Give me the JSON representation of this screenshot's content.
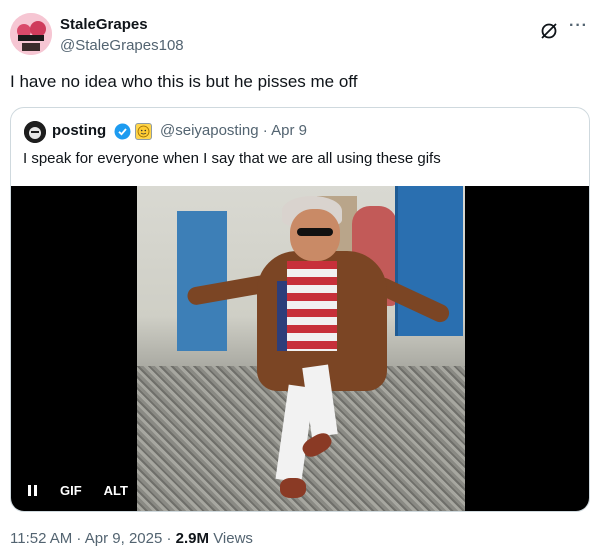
{
  "tweet": {
    "author_name": "StaleGrapes",
    "author_handle": "@StaleGrapes108",
    "text": "I have no idea who this is but he pisses me off",
    "timestamp": "11:52 AM · Apr 9, 2025 ·",
    "views_count": "2.9M",
    "views_label": "Views"
  },
  "quoted": {
    "author_name": "posting",
    "author_handle": "@seiyaposting · Apr 9",
    "text": "I speak for everyone when I say that we are all using these gifs",
    "verified": true
  },
  "media": {
    "type": "GIF",
    "gif_label": "GIF",
    "alt_label": "ALT",
    "playing": true
  },
  "icons": {
    "grok": "grok-icon",
    "more": "more-icon",
    "verified": "verified-badge-icon",
    "pause": "pause-icon"
  },
  "colors": {
    "text_primary": "#0f1419",
    "text_secondary": "#536471",
    "verified_blue": "#1d9bf0",
    "border": "#cfd9de"
  }
}
